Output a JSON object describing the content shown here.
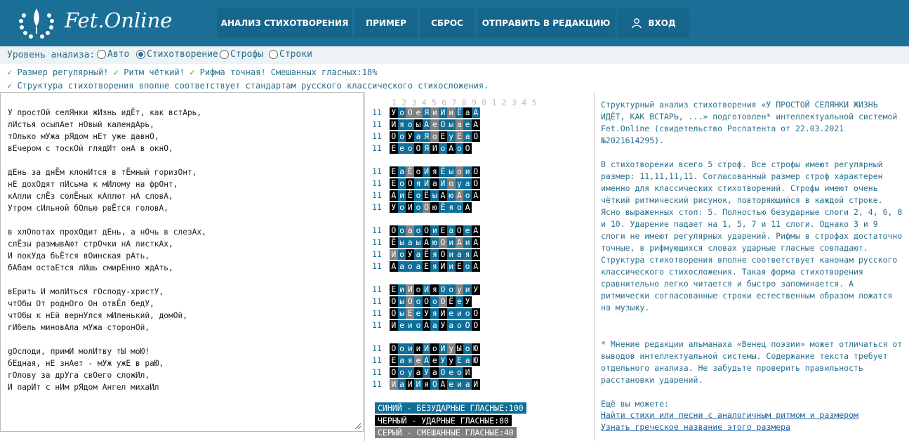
{
  "header": {
    "brand": "Fet.Online",
    "nav": [
      {
        "label": "АНАЛИЗ СТИХОТВОРЕНИЯ"
      },
      {
        "label": "ПРИМЕР"
      },
      {
        "label": "СБРОС"
      },
      {
        "label": "ОТПРАВИТЬ В РЕДАКЦИЮ"
      },
      {
        "label": "ВХОД",
        "icon": "user-icon"
      }
    ]
  },
  "level": {
    "label": "Уровень анализа:",
    "options": [
      "Авто",
      "Стихотворение",
      "Строфы",
      "Строки"
    ],
    "selected": "Стихотворение"
  },
  "status": {
    "line1": [
      "Размер регулярный!",
      "Ритм чёткий!",
      "Рифма точная! Смешанных гласных:18%"
    ],
    "line2": " Структура стихотворения вполне соответствует стандартам русского классического стихосложения."
  },
  "poem": "У простОй селЯнки жИзнь идЁт, как встАрь,\nлИстья осыпАет нОвый календАрь,\nтОлько мУжа рЯдом нЕт уже давнО,\nвЕчером с тоскОй глядИт онА в окнО,\n\nдЕнь за днЁм клонИтся в тЁмный горизОнт,\nнЕ дохОдят пИсьма к мИлому на фрОнт,\nкАпли слЁз солЁных кАплют нА словА,\nУтром сИльной бОлью рвЁтся головА,\n\nв хлОпотах прохОдит дЕнь, а нОчь в слезАх,\nслЁзы размывАют стрОчки нА листкАх,\nИ покУда бьЁтся вОинская рАть,\nбАбам остаЕтся лИшь смирЕнно ждАть,\n\nвЕрить И молИться гОсподу-христУ,\nчтОбы От роднОго Он отвЁл бедУ,\nчтОбы к нЕй вернУлся мИленький, домОй,\nгИбель миновАла мУжа сторонОй,\n\ngОсподи, примИ молИтву тЫ моЮ!\nбЕдная, нЕ знАет - мУж ужЕ в раЮ,\nгОлову за дрУга свОего сложИл,\nИ парИт с нИм рЯдом Ангел михаИл",
  "analysis": {
    "ruler": "1 2 3 4 5 6 7 8 9 0 1 2 3 4 5",
    "stanzas": [
      [
        {
          "n": "11",
          "letters": "УоОеЯиИиЁаА",
          "pattern": "102202020101"
        },
        {
          "n": "11",
          "letters": "ИяоыАеОыаеА",
          "pattern": "10010200201"
        },
        {
          "n": "11",
          "letters": "ОоУаЯоЕуЕаО",
          "pattern": "10100210201"
        },
        {
          "n": "11",
          "letters": "ЕеоОЯИоАоО",
          "pattern": "1001010101"
        }
      ],
      [
        {
          "n": "11",
          "letters": "ЕаЁоИяЁыоиО",
          "pattern": "10210100201"
        },
        {
          "n": "11",
          "letters": "ЕоОяИаИоуаО",
          "pattern": "10100102001"
        },
        {
          "n": "11",
          "letters": "АиЁоЁыАюАоА",
          "pattern": "10101010201"
        },
        {
          "n": "11",
          "letters": "УоИоОюЁяоА",
          "pattern": "1010210001"
        }
      ],
      [
        {
          "n": "11",
          "letters": "ОоаоОиЕаОеА",
          "pattern": "10201010101"
        },
        {
          "n": "11",
          "letters": "ЁыаыАюОиАиА",
          "pattern": "10001020201"
        },
        {
          "n": "11",
          "letters": "ИоУаЁяОиаяА",
          "pattern": "20101010001"
        },
        {
          "n": "11",
          "letters": "АаоаЕяИиЕоА",
          "pattern": "10001010101"
        }
      ],
      [
        {
          "n": "11",
          "letters": "ЕиИоИяОоуиУ",
          "pattern": "10210100201"
        },
        {
          "n": "11",
          "letters": "ОыОоОоОЁеУ",
          "pattern": "1020102101"
        },
        {
          "n": "11",
          "letters": "ОыЕеУяИеиоО",
          "pattern": "10201010001"
        },
        {
          "n": "11",
          "letters": "ИеиоАаУаоОО",
          "pattern": "10001010001"
        }
      ],
      [
        {
          "n": "11",
          "letters": "ОоииИоИуЫоЮ",
          "pattern": "10010102101"
        },
        {
          "n": "11",
          "letters": "ЕаяеАеУуЕаЮ",
          "pattern": "10020101001"
        },
        {
          "n": "11",
          "letters": "ОоуаУаОеоИ",
          "pattern": "1001010001"
        },
        {
          "n": "11",
          "letters": "ИаИИяОАеиаИ",
          "pattern": "20101010001"
        }
      ]
    ],
    "legend": {
      "blue": "СИНИЙ - БЕЗУДАРНЫЕ ГЛАСНЫЕ:100",
      "black": "ЧЕРНЫЙ - УДАРНЫЕ ГЛАСНЫЕ:80",
      "gray": "СЕРЫЙ - СМЕШАННЫЕ ГЛАСНЫЕ:40"
    },
    "colors": {
      "blue": "#0f6f98",
      "black": "#000000",
      "gray": "#808080"
    }
  },
  "description": {
    "p1": "Структурный анализ стихотворения «У ПРОСТОЙ СЕЛЯНКИ ЖИЗНЬ ИДЁТ, КАК ВСТАРЬ, ...» подготовлен* интеллектуальной системой Fet.Online (свидетельство Роспатента от 22.03.2021 №2021614295).",
    "p2": "В стихотворении всего 5 строф. Все строфы имеют регулярный размер: 11,11,11,11. Согласованный размер строф характерен именно для классических стихотворений. Строфы имеют очень чёткий ритмический рисунок, повторяющийся в каждой строке. Ясно выраженных стоп: 5. Полностью безударные слоги 2, 4, 6, 8 и 10. Ударение падает на 1, 5, 7 и 11 слоги. Однако 3 и 9 слоги не имеют регулярных ударений. Рифмы в строфах достаточно точные, в рифмующихся словах ударные гласные совпадают. Структура стихотворения вполне соответствует канонам русского классического стихосложения. Такая форма стихотворения сравнительно легко читается и быстро запоминается. А ритмически согласованные строки естественным образом ложатся на музыку.",
    "p3": "* Мнение редакции альманаха «Венец поэзии» может отличаться от выводов интеллектуальной системы. Содержание текста требует отдельного анализа. Не забудьте проверить правильность расстановки ударений.",
    "more": "Ещё вы можете:",
    "link1": "Найти стихи или песни с аналогичным ритмом и размером",
    "link2": "Узнать греческое название этого размера"
  }
}
